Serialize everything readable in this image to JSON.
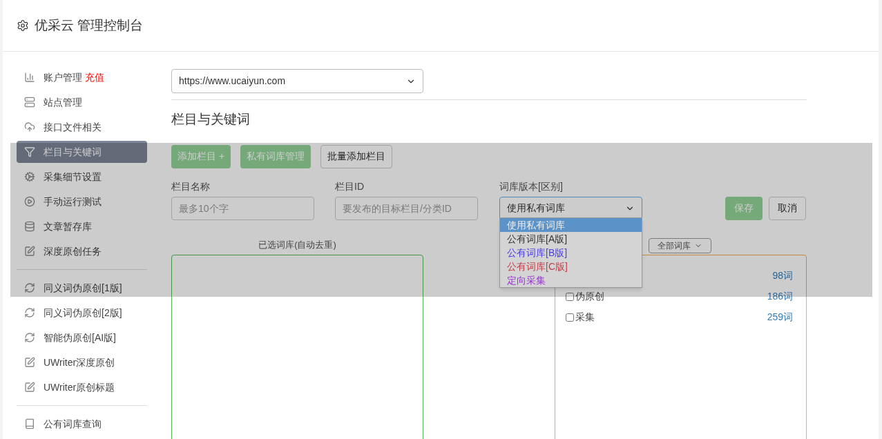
{
  "header": {
    "title": "优采云 管理控制台"
  },
  "sidebar": {
    "groups": [
      {
        "items": [
          {
            "label": "账户管理",
            "badge": "充值",
            "selected": false
          },
          {
            "label": "站点管理",
            "selected": false
          },
          {
            "label": "接口文件相关",
            "selected": false
          },
          {
            "label": "栏目与关键词",
            "selected": true
          },
          {
            "label": "采集细节设置",
            "selected": false
          },
          {
            "label": "手动运行测试",
            "selected": false
          },
          {
            "label": "文章暂存库",
            "selected": false
          },
          {
            "label": "深度原创任务",
            "selected": false
          }
        ]
      },
      {
        "items": [
          {
            "label": "同义词伪原创[1版]",
            "selected": false
          },
          {
            "label": "同义词伪原创[2版]",
            "selected": false
          },
          {
            "label": "智能伪原创[AI版]",
            "selected": false
          },
          {
            "label": "UWriter深度原创",
            "selected": false
          },
          {
            "label": "UWriter原创标题",
            "selected": false
          }
        ]
      },
      {
        "items": [
          {
            "label": "公有词库查询",
            "selected": false
          }
        ]
      }
    ]
  },
  "site_select": {
    "value": "https://www.ucaiyun.com"
  },
  "section_title": "栏目与关键词",
  "buttons": [
    {
      "label": "添加栏目 +",
      "kind": "primary"
    },
    {
      "label": "私有词库管理",
      "kind": "primary"
    },
    {
      "label": "批量添加栏目",
      "kind": "outline"
    }
  ],
  "form": {
    "name": {
      "label": "栏目名称",
      "placeholder": "最多10个字"
    },
    "id": {
      "label": "栏目ID",
      "placeholder": "要发布的目标栏目/分类ID"
    },
    "version": {
      "label": "词库版本[区别]",
      "value": "使用私有词库",
      "options": [
        {
          "label": "使用私有词库",
          "selected": true
        },
        {
          "label": "公有词库[A版]",
          "selected": false,
          "color": "#333333"
        },
        {
          "label": "公有词库[B版]",
          "selected": false,
          "color": "#4b3fe0"
        },
        {
          "label": "公有词库[C版]",
          "selected": false,
          "color": "#c0404a"
        },
        {
          "label": "定向采集",
          "selected": false,
          "color": "#9b30d9"
        }
      ]
    },
    "save": "保存",
    "cancel": "取消"
  },
  "selected_panel": {
    "title": "已选词库(自动去重)"
  },
  "library_filter": {
    "value": "全部词库"
  },
  "libraries": [
    {
      "count": "98词"
    },
    {
      "label": "伪原创",
      "checked": false,
      "count": "186词"
    },
    {
      "label": "采集",
      "checked": false,
      "count": "259词"
    }
  ]
}
